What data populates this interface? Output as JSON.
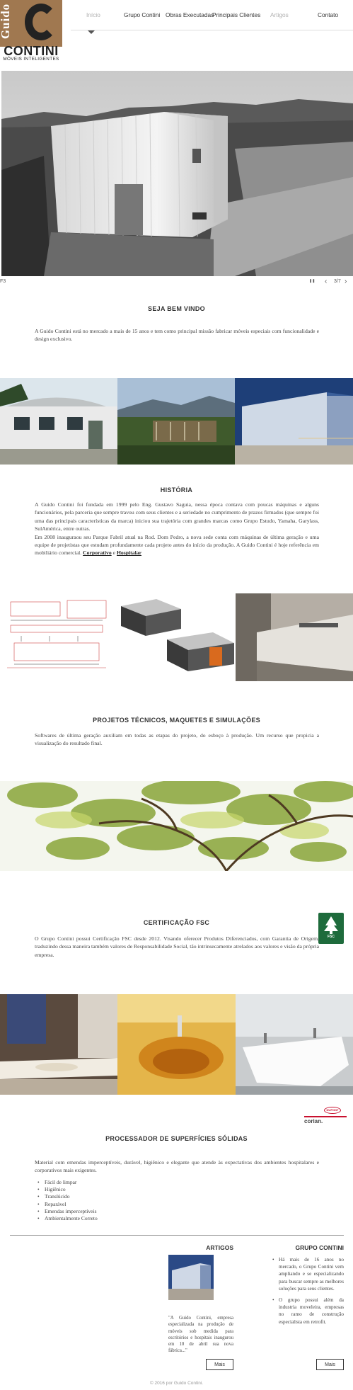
{
  "brand": {
    "logo_guido": "Guido",
    "logo_word": "CONTINI",
    "logo_tagline": "MÓVEIS INTELIGENTES"
  },
  "nav": [
    {
      "label": "Início"
    },
    {
      "label": "Grupo Contini"
    },
    {
      "label": "Obras Executadas"
    },
    {
      "label": "Principais Clientes"
    },
    {
      "label": "Artigos"
    },
    {
      "label": "Contato"
    }
  ],
  "slideshow": {
    "caption": "F3",
    "counter": "3/7",
    "prev_glyph": "‹",
    "next_glyph": "›",
    "pause_glyph": "❚❚"
  },
  "welcome": {
    "title": "SEJA BEM VINDO",
    "text": "A Guido Contini está no mercado a mais de 15 anos e tem como principal missão fabricar móveis especiais com funcionalidade e design exclusivo."
  },
  "historia": {
    "title": "HISTÓRIA",
    "text": "A Guido Contini foi fundada em 1999 pelo Eng. Gustavo Saguia, nessa época contava com poucas máquinas e alguns funcionários, pela parceria que sempre travou com seus clientes e a seriedade no cumprimento de prazos firmados (que sempre foi uma das principais características da marca) iniciou sua trajetória com grandes marcas como Grupo Estudo, Yamaha, Garylass, SulAmérica, entre outras.",
    "text2": "Em 2008 inauguraou seu Parque Fabril atual na Rod. Dom Pedro, a nova sede conta com máquinas de última geração e uma equipe de projetistas que estudam profundamente cada projeto antes do início da produção. A Guido Contini é hoje referência em mobiliário comercial.",
    "link_corporativo": "Corporativo",
    "link_sep": "e",
    "link_hospitalar": "Hospitalar"
  },
  "projetos": {
    "title": "PROJETOS TÉCNICOS, MAQUETES E SIMULAÇÕES",
    "text": "Softwares de última geração auxiliam em todas as etapas do projeto, do esboço à produção. Um recurso que propicia a visualização do resultado final."
  },
  "fsc": {
    "title": "CERTIFICAÇÃO FSC",
    "badge_text": "FSC",
    "text": "O Grupo Contini possui Certificação FSC desde 2012. Visando oferecer Produtos Diferenciados, com Garantia de Origem, traduzindo dessa maneira também valores de Responsabilidade Social, tão intrinsecamente atrelados aos valores e visão da própria empresa."
  },
  "superficies": {
    "title": "PROCESSADOR DE SUPERFÍCIES SÓLIDAS",
    "dupont": "DUPONT",
    "corian": "corian.",
    "text": "Material com emendas imperceptíveis, durável, higiênico e elegante que atende às expectativas dos ambientes hospitalares e corporativos mais exigentes.",
    "items": [
      "Fácil de limpar",
      "Higiênico",
      "Translúcido",
      "Reparável",
      "Emendas imperceptíveis",
      "Ambientalmente Correto"
    ]
  },
  "artigos": {
    "title": "ARTIGOS",
    "quote": "\"A Guido Contini, empresa especializada na produção de móveis sob medida para escritórios e hospitais inaugurou em 10 de abril sua nova fábrica...\"",
    "button": "Mais"
  },
  "grupo": {
    "title": "GRUPO CONTINI",
    "items": [
      "Há mais de 16 anos no mercado, o Grupo Contini vem ampliando e se especializando para buscar sempre as melhores soluções para seus clientes.",
      "O grupo possui além da industria moveleira, empresas no ramo de construção especialista em retrofit."
    ],
    "button": "Mais"
  },
  "footer": {
    "copyright": "© 2016 por Guido Contini."
  },
  "colors": {
    "logo_brown": "#a07850",
    "fsc_green": "#1e6b3c",
    "dupont_red": "#c8102e"
  }
}
